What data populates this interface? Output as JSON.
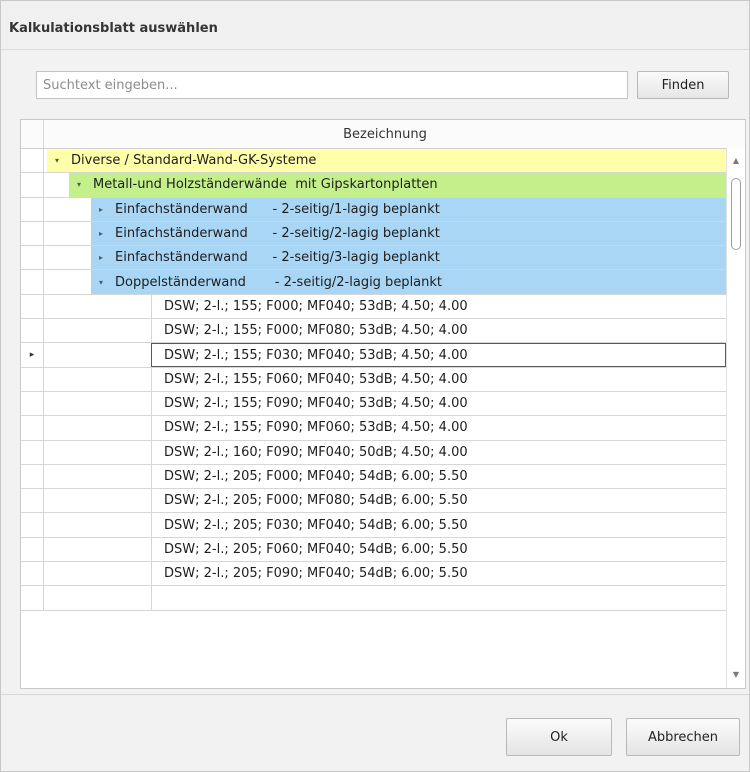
{
  "dialog": {
    "title": "Kalkulationsblatt auswählen",
    "search": {
      "placeholder": "Suchtext eingeben...",
      "value": ""
    },
    "find_label": "Finden",
    "ok_label": "Ok",
    "cancel_label": "Abbrechen"
  },
  "grid": {
    "column_header": "Bezeichnung",
    "rows": [
      {
        "level": "group0",
        "expander": "▾",
        "label": "Diverse / Standard-Wand-GK-Systeme"
      },
      {
        "level": "group1",
        "expander": "▾",
        "label": "Metall-und Holzständerwände  mit Gipskartonplatten"
      },
      {
        "level": "group2",
        "expander": "▸",
        "label": "Einfachständerwand      - 2-seitig/1-lagig beplankt"
      },
      {
        "level": "group2",
        "expander": "▸",
        "label": "Einfachständerwand      - 2-seitig/2-lagig beplankt"
      },
      {
        "level": "group2",
        "expander": "▸",
        "label": "Einfachständerwand      - 2-seitig/3-lagig beplankt"
      },
      {
        "level": "group2",
        "expander": "▾",
        "label": "Doppelständerwand       - 2-seitig/2-lagig beplankt"
      },
      {
        "level": "leaf",
        "label": "DSW; 2-l.; 155; F000; MF040; 53dB; 4.50; 4.00"
      },
      {
        "level": "leaf",
        "label": "DSW; 2-l.; 155; F000; MF080; 53dB; 4.50; 4.00"
      },
      {
        "level": "leaf",
        "label": "DSW; 2-l.; 155; F030; MF040; 53dB; 4.50; 4.00",
        "focused": true
      },
      {
        "level": "leaf",
        "label": "DSW; 2-l.; 155; F060; MF040; 53dB; 4.50; 4.00"
      },
      {
        "level": "leaf",
        "label": "DSW; 2-l.; 155; F090; MF040; 53dB; 4.50; 4.00"
      },
      {
        "level": "leaf",
        "label": "DSW; 2-l.; 155; F090; MF060; 53dB; 4.50; 4.00"
      },
      {
        "level": "leaf",
        "label": "DSW; 2-l.; 160; F090; MF040; 50dB; 4.50; 4.00"
      },
      {
        "level": "leaf",
        "label": "DSW; 2-l.; 205; F000; MF040; 54dB; 6.00; 5.50"
      },
      {
        "level": "leaf",
        "label": "DSW; 2-l.; 205; F000; MF080; 54dB; 6.00; 5.50"
      },
      {
        "level": "leaf",
        "label": "DSW; 2-l.; 205; F030; MF040; 54dB; 6.00; 5.50"
      },
      {
        "level": "leaf",
        "label": "DSW; 2-l.; 205; F060; MF040; 54dB; 6.00; 5.50"
      },
      {
        "level": "leaf",
        "label": "DSW; 2-l.; 205; F090; MF040; 54dB; 6.00; 5.50"
      },
      {
        "level": "leaf",
        "label": ""
      }
    ],
    "row_indicator_icon": "▸"
  },
  "colors": {
    "group0_bg": "#ffffaa",
    "group1_bg": "#c4f08c",
    "group2_bg": "#a9d6f5"
  }
}
